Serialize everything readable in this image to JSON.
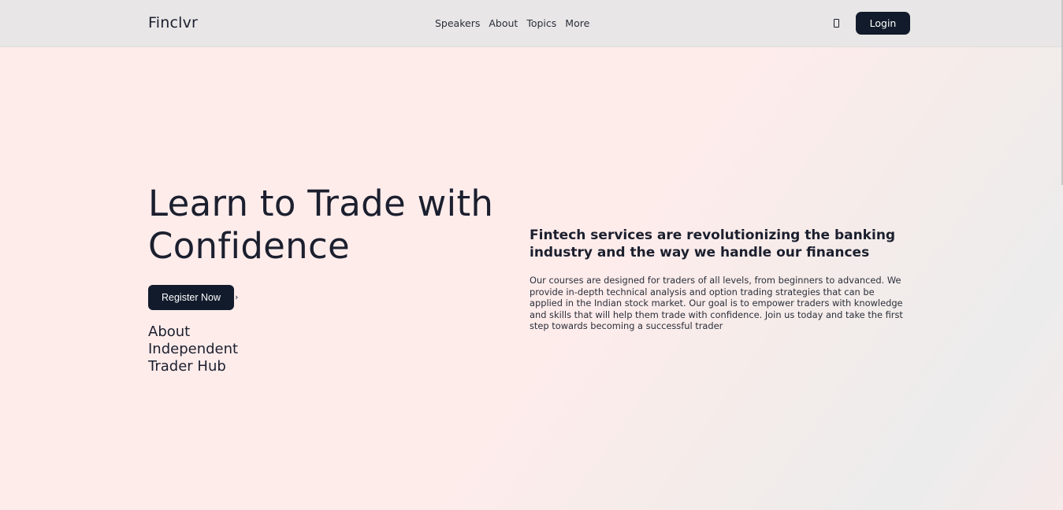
{
  "navbar": {
    "brand": "Finclvr",
    "links": [
      "Speakers",
      "About",
      "Topics",
      "More"
    ],
    "theme_icon": "phone-icon",
    "login_label": "Login"
  },
  "hero": {
    "title": "Learn to Trade with Confidence",
    "register_label": "Register Now",
    "register_icon": "chevron-right-icon",
    "about_label": "About Independent Trader Hub",
    "subheading": "Fintech services are revolutionizing the banking industry and the way we handle our finances",
    "description": "Our courses are designed for traders of all levels, from beginners to advanced. We provide in-depth technical analysis and option trading strategies that can be applied in the Indian stock market. Our goal is to empower traders with knowledge and skills that will help them trade with confidence. Join us today and take the first step towards becoming a successful trader"
  },
  "colors": {
    "primary_dark": "#111b2b",
    "text": "#1b1f2e",
    "navbar_bg": "#e8e6e6",
    "page_bg": "#feeceb"
  }
}
